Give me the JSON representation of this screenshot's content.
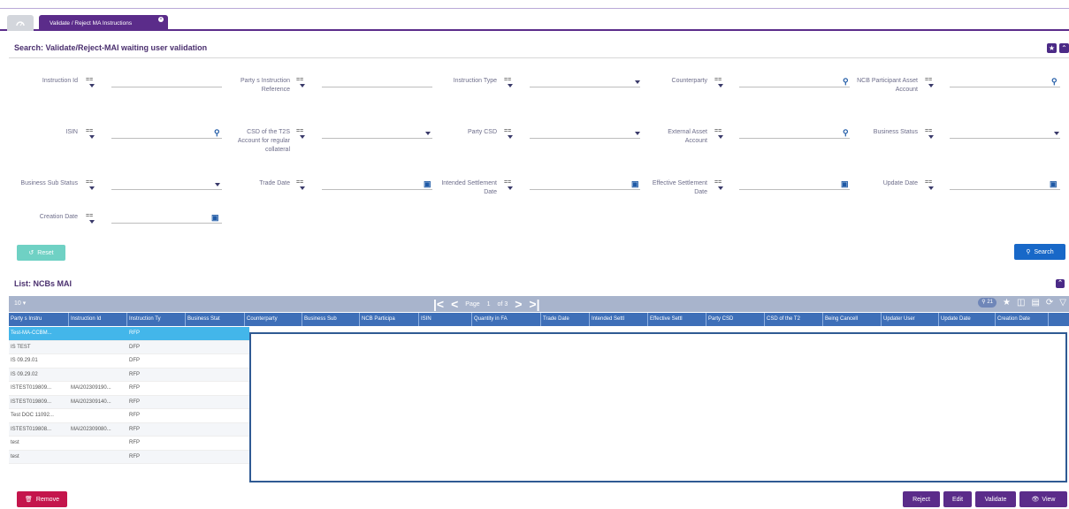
{
  "tabs": {
    "home_icon": "dashboard-icon",
    "active_label": "Validate / Reject MA Instructions"
  },
  "search": {
    "title": "Search: Validate/Reject-MAI waiting user validation",
    "operator": "==",
    "fields": {
      "instruction_id": "Instruction Id",
      "party_ref": "Party s Instruction Reference",
      "instruction_type": "Instruction Type",
      "counterparty": "Counterparty",
      "ncb_asset": "NCB Participant Asset Account",
      "isin": "ISIN",
      "csd_t2s": "CSD of the T2S Account for regular collateral",
      "party_csd": "Party CSD",
      "external_asset": "External Asset Account",
      "business_status": "Business Status",
      "business_sub_status": "Business Sub Status",
      "trade_date": "Trade Date",
      "intended_settlement": "Intended Settlement Date",
      "effective_settlement": "Effective Settlement Date",
      "update_date": "Update Date",
      "creation_date": "Creation Date"
    },
    "reset_label": "Reset",
    "search_label": "Search"
  },
  "list": {
    "title": "List: NCBs MAI",
    "page_size": "10",
    "page_label": "Page",
    "page_num": "1",
    "page_of": "of 3",
    "count": "21",
    "columns": [
      "Party s Instru",
      "Instruction Id",
      "Instruction Ty",
      "Business Stat",
      "Counterparty",
      "Business Sub",
      "NCB Participa",
      "ISIN",
      "Quantity in FA",
      "Trade Date",
      "Intended Settl",
      "Effective Settl",
      "Party CSD",
      "CSD of the T2",
      "Being Cancell",
      "Updater User",
      "Update Date",
      "Creation Date"
    ],
    "rows": [
      [
        "Test-MA-CCBM...",
        "",
        "RFP"
      ],
      [
        "IS TEST",
        "",
        "DFP"
      ],
      [
        "IS 09.29.01",
        "",
        "DFP"
      ],
      [
        "IS 09.29.02",
        "",
        "RFP"
      ],
      [
        "ISTEST019809...",
        "MAI202309190...",
        "RFP"
      ],
      [
        "ISTEST019809...",
        "MAI202309140...",
        "RFP"
      ],
      [
        "Test DOC 11092...",
        "",
        "RFP"
      ],
      [
        "ISTEST019808...",
        "MAI202309080...",
        "RFP"
      ],
      [
        "test",
        "",
        "RFP"
      ],
      [
        "test",
        "",
        "RFP"
      ]
    ]
  },
  "actions": {
    "remove": "Remove",
    "reject": "Reject",
    "edit": "Edit",
    "validate": "Validate",
    "view": "View"
  }
}
